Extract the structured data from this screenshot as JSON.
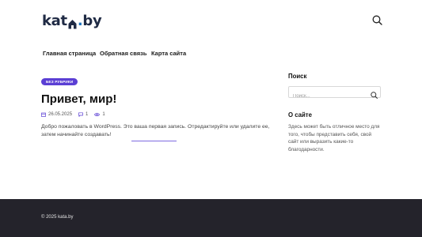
{
  "header": {
    "logo_left": "kat",
    "logo_right": "by",
    "logo_dot": "."
  },
  "nav": {
    "items": [
      "Главная страница",
      "Обратная связь",
      "Карта сайта"
    ]
  },
  "post": {
    "category": "БЕЗ РУБРИКИ",
    "title": "Привет, мир!",
    "date": "26.05.2025",
    "comments": "1",
    "views": "1",
    "excerpt": "Добро пожаловать в WordPress. Это ваша первая запись. Отредактируйте или удалите ее, затем начинайте создавать!"
  },
  "sidebar": {
    "search_title": "Поиск",
    "search_placeholder": "Поиск...",
    "about_title": "О сайте",
    "about_text": "Здесь может быть отличное место для того, чтобы представить себя, свой сайт или выразить какие-то благодарности."
  },
  "footer": {
    "copyright": "© 2025 kata.by"
  },
  "colors": {
    "accent": "#5b3fd4",
    "footer_bg": "#24232b",
    "logo": "#1f2a44"
  }
}
